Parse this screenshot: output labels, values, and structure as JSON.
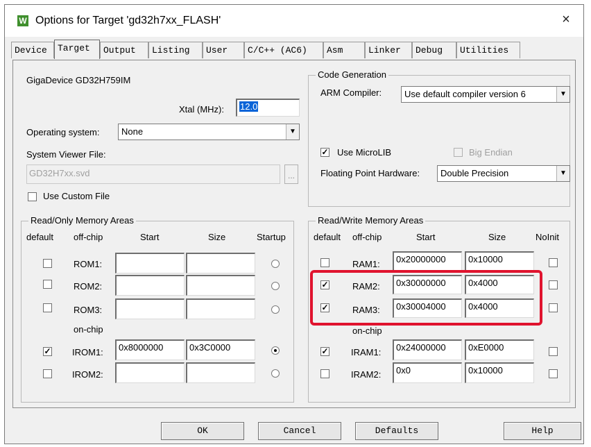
{
  "window": {
    "title": "Options for Target 'gd32h7xx_FLASH'",
    "icon": "keil-uvision-icon",
    "close": "×"
  },
  "tabs": [
    "Device",
    "Target",
    "Output",
    "Listing",
    "User",
    "C/C++ (AC6)",
    "Asm",
    "Linker",
    "Debug",
    "Utilities"
  ],
  "active_tab": "Target",
  "device": "GigaDevice GD32H759IM",
  "xtal": {
    "label": "Xtal (MHz):",
    "value": "12.0"
  },
  "os": {
    "label": "Operating system:",
    "value": "None"
  },
  "svd": {
    "label": "System Viewer File:",
    "value": "GD32H7xx.svd",
    "browse": "..."
  },
  "use_custom_file": {
    "label": "Use Custom File",
    "checked": false
  },
  "code_gen": {
    "title": "Code Generation",
    "compiler_label": "ARM Compiler:",
    "compiler_value": "Use default compiler version 6",
    "microlib": {
      "label": "Use MicroLIB",
      "checked": true
    },
    "big_endian": {
      "label": "Big Endian",
      "checked": false
    },
    "fpu_label": "Floating Point Hardware:",
    "fpu_value": "Double Precision"
  },
  "ro_mem": {
    "title": "Read/Only Memory Areas",
    "headers": {
      "default": "default",
      "offchip": "off-chip",
      "start": "Start",
      "size": "Size",
      "startup": "Startup"
    },
    "onchip_label": "on-chip",
    "rows": [
      {
        "name": "ROM1:",
        "default": false,
        "start": "",
        "size": "",
        "startup": false
      },
      {
        "name": "ROM2:",
        "default": false,
        "start": "",
        "size": "",
        "startup": false
      },
      {
        "name": "ROM3:",
        "default": false,
        "start": "",
        "size": "",
        "startup": false
      },
      {
        "name": "IROM1:",
        "default": true,
        "start": "0x8000000",
        "size": "0x3C0000",
        "startup": true
      },
      {
        "name": "IROM2:",
        "default": false,
        "start": "",
        "size": "",
        "startup": false
      }
    ]
  },
  "rw_mem": {
    "title": "Read/Write Memory Areas",
    "headers": {
      "default": "default",
      "offchip": "off-chip",
      "start": "Start",
      "size": "Size",
      "noinit": "NoInit"
    },
    "onchip_label": "on-chip",
    "rows": [
      {
        "name": "RAM1:",
        "default": false,
        "start": "0x20000000",
        "size": "0x10000",
        "noinit": false
      },
      {
        "name": "RAM2:",
        "default": true,
        "start": "0x30000000",
        "size": "0x4000",
        "noinit": false
      },
      {
        "name": "RAM3:",
        "default": true,
        "start": "0x30004000",
        "size": "0x4000",
        "noinit": false
      },
      {
        "name": "IRAM1:",
        "default": true,
        "start": "0x24000000",
        "size": "0xE0000",
        "noinit": false
      },
      {
        "name": "IRAM2:",
        "default": false,
        "start": "0x0",
        "size": "0x10000",
        "noinit": false
      }
    ]
  },
  "buttons": {
    "ok": "OK",
    "cancel": "Cancel",
    "defaults": "Defaults",
    "help": "Help"
  },
  "highlight_color": "#e0132e"
}
